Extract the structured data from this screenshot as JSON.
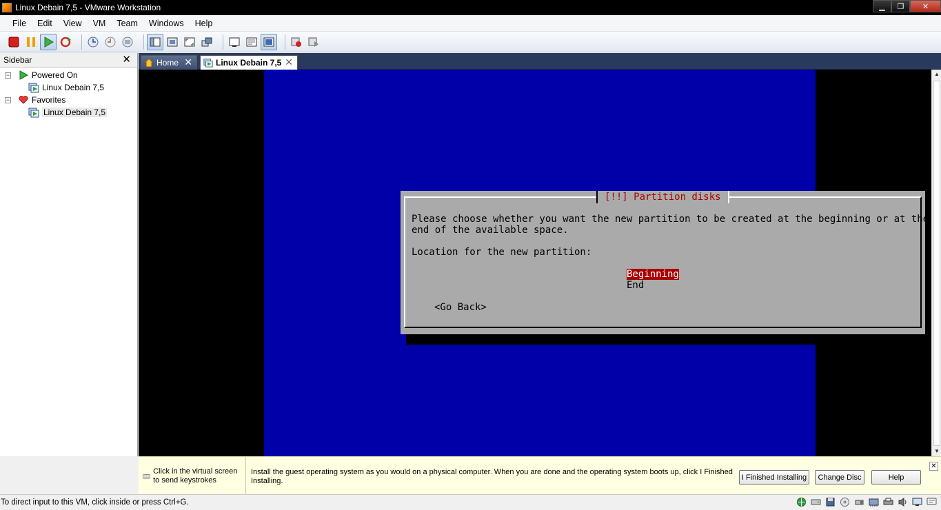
{
  "window": {
    "title": "Linux Debain 7,5 - VMware Workstation",
    "controls": {
      "minimize": "▁",
      "maximize": "❐",
      "close": "✕"
    }
  },
  "menu": [
    "File",
    "Edit",
    "View",
    "VM",
    "Team",
    "Windows",
    "Help"
  ],
  "toolbar": {
    "groups": [
      [
        "stop-icon",
        "pause-icon",
        "play-icon",
        "reset-icon"
      ],
      [
        "snapshot-icon",
        "revert-snapshot-icon",
        "snapshot-manager-icon"
      ],
      [
        "show-sidebar-icon",
        "quick-switch-icon",
        "full-screen-icon",
        "unity-icon"
      ],
      [
        "console-view-icon",
        "summary-view-icon",
        "thumbnail-view-icon"
      ],
      [
        "record-icon",
        "replay-icon"
      ]
    ]
  },
  "sidebar": {
    "title": "Sidebar",
    "close": "✕",
    "groups": [
      {
        "label": "Powered On",
        "expander": "−",
        "icon": "play-icon",
        "items": [
          "Linux Debain 7,5"
        ]
      },
      {
        "label": "Favorites",
        "expander": "−",
        "icon": "heart-icon",
        "items": [
          "Linux Debain 7,5"
        ]
      }
    ]
  },
  "tabs": [
    {
      "label": "Home",
      "active": false,
      "close": "✕"
    },
    {
      "label": "Linux Debain 7,5",
      "active": true,
      "close": "✕"
    }
  ],
  "installer": {
    "title": "[!!] Partition disks",
    "line1": "Please choose whether you want the new partition to be created at the beginning or at the",
    "line2": "end of the available space.",
    "prompt": "Location for the new partition:",
    "options": [
      "Beginning",
      "End"
    ],
    "selected_option": "Beginning",
    "back_button": "<Go Back>",
    "colors": {
      "screen": "#0000a8",
      "dialog": "#aaaaaa",
      "title": "#a80000",
      "selection": "#a80000"
    }
  },
  "infobar": {
    "hint": "Click in the virtual screen to send keystrokes",
    "message": "Install the guest operating system as you would on a physical computer. When you are done and the operating system boots up, click I Finished Installing.",
    "buttons": [
      "I Finished Installing",
      "Change Disc",
      "Help"
    ],
    "close": "✕"
  },
  "statusbar": {
    "text": "To direct input to this VM, click inside or press Ctrl+G.",
    "icons": [
      "network-icon",
      "hard-disk-icon",
      "floppy-icon",
      "cd-icon",
      "usb-icon",
      "network-adapter-icon",
      "printer-icon",
      "sound-icon",
      "display-icon",
      "messages-icon"
    ]
  }
}
